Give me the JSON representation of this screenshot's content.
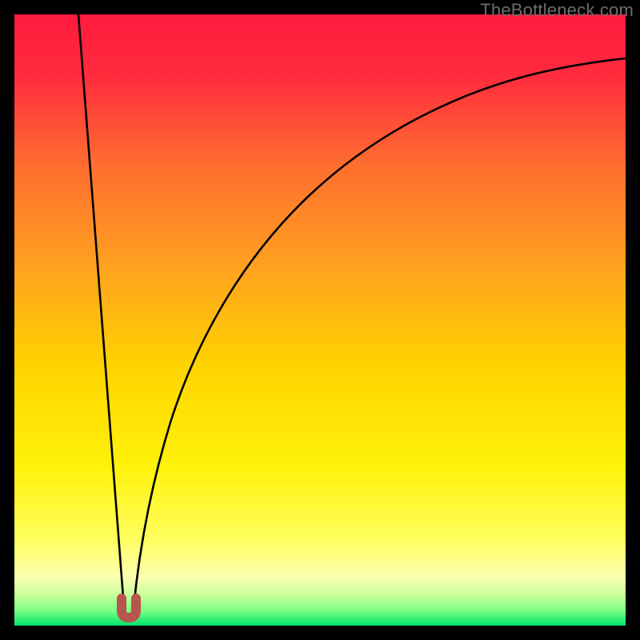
{
  "watermark": "TheBottleneck.com",
  "chart_data": {
    "type": "line",
    "title": "",
    "xlabel": "",
    "ylabel": "",
    "xlim": [
      0,
      100
    ],
    "ylim": [
      0,
      100
    ],
    "grid": false,
    "legend": false,
    "background_gradient": {
      "top_color": "#ff1a3f",
      "mid_color_1": "#ff7b2a",
      "mid_color_2": "#ffd400",
      "mid_color_3": "#ffff60",
      "bottom_color": "#00e66b"
    },
    "series": [
      {
        "name": "bottleneck-curve-left",
        "type": "line",
        "x": [
          10.5,
          11.5,
          12.5,
          13.5,
          14.5,
          15.5,
          16.5,
          17.5,
          18.0
        ],
        "y": [
          100,
          87,
          74,
          61,
          48,
          35,
          22,
          9,
          2.5
        ]
      },
      {
        "name": "bottleneck-curve-right",
        "type": "line",
        "x": [
          19.5,
          20,
          21,
          23,
          26,
          30,
          35,
          41,
          48,
          56,
          65,
          75,
          86,
          100
        ],
        "y": [
          2.5,
          6,
          14,
          27,
          40,
          51,
          61,
          69,
          76,
          81,
          85,
          88,
          90.5,
          92.5
        ]
      }
    ],
    "marker": {
      "name": "optimal-point",
      "x": 18.7,
      "y": 2.3,
      "shape": "u",
      "color": "#b7554e"
    }
  }
}
